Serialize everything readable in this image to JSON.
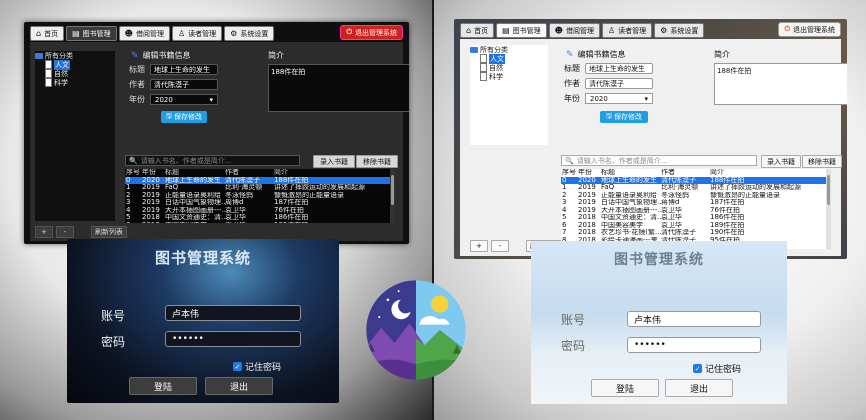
{
  "app": {
    "tabs": [
      {
        "label": "首页",
        "icon": "home-icon"
      },
      {
        "label": "图书管理",
        "icon": "book-icon"
      },
      {
        "label": "借阅管理",
        "icon": "people-icon"
      },
      {
        "label": "读者管理",
        "icon": "user-icon"
      },
      {
        "label": "系统设置",
        "icon": "gear-icon"
      }
    ],
    "logout_label": "退出管理系统"
  },
  "tree": {
    "root": "所有分类",
    "children": [
      "人文",
      "自然",
      "科学"
    ],
    "selected": "人文",
    "buttons": {
      "add": "+",
      "remove": "-",
      "refresh": "刷新列表"
    }
  },
  "editor": {
    "title": "编辑书籍信息",
    "title_label": "标题",
    "title_value": "地球上生命的发生",
    "author_label": "作者",
    "author_value": "清代陈漠子",
    "year_label": "年份",
    "year_value": "2020",
    "intro_label": "简介",
    "intro_value": "188件在拍",
    "save_label": "保存修改"
  },
  "search": {
    "placeholder": "请输入书名、作者或是简介...",
    "import_label": "录入书籍",
    "delete_label": "移除书籍"
  },
  "table": {
    "headers": [
      "序号",
      "年份",
      "标题",
      "作者",
      "简介"
    ],
    "dark_rows": [
      [
        "0",
        "2020",
        "地球上生命的发生",
        "清代陈漠子",
        "188件在拍"
      ],
      [
        "1",
        "2019",
        "FaQ",
        "比利·海灵顿",
        "讲述了摔跤运动的发展和起源"
      ],
      [
        "2",
        "2019",
        "正能量语录奥利给",
        "冬泳怪鸽",
        "慷慨激昂的正能量语录"
      ],
      [
        "3",
        "2019",
        "白话中国气象物理...",
        "周博d",
        "187件在拍"
      ],
      [
        "4",
        "2019",
        "大开本插图画册---...",
        "袁卫华",
        "76件在拍"
      ],
      [
        "5",
        "2018",
        "中国文资通史：清...",
        "袁卫华",
        "186件在拍"
      ],
      [
        "6",
        "2018",
        "中国美容美学",
        "袁卫华",
        "189件在拍"
      ],
      [
        "7",
        "2018",
        "农艺珍书·花镜(繁...",
        "清代陈漠子",
        "190件在拍"
      ],
      [
        "8",
        "2018",
        "彩绘卡通漫画---鬼...",
        "清代陈漠子",
        "95件在拍"
      ]
    ],
    "light_rows": [
      [
        "0",
        "2020",
        "地球上生命的发生",
        "清代陈漠子",
        "188件在拍"
      ],
      [
        "1",
        "2019",
        "FaQ",
        "比利·海灵顿",
        "讲述了摔跤运动的发展和起源"
      ],
      [
        "2",
        "2019",
        "正能量语录奥利给",
        "冬泳怪鸽",
        "慷慨激昂的正能量语录"
      ],
      [
        "3",
        "2019",
        "白话中国气象物理...",
        "蒋博d",
        "187件在拍"
      ],
      [
        "4",
        "2019",
        "大开本插图画册---...",
        "袁卫华",
        "76件在拍"
      ],
      [
        "5",
        "2018",
        "中国文资通史：清...",
        "袁卫华",
        "186件在拍"
      ],
      [
        "6",
        "2018",
        "中国美容美学",
        "袁卫华",
        "189件在拍"
      ],
      [
        "7",
        "2018",
        "农艺珍书·花镜(繁...",
        "清代陈漠子",
        "190件在拍"
      ],
      [
        "8",
        "2018",
        "彩绘卡通漫画---鬼...",
        "清代陈漠子",
        "95件在拍"
      ]
    ]
  },
  "login": {
    "title": "图书管理系统",
    "account_label": "账号",
    "account_value": "卢本伟",
    "password_label": "密码",
    "password_value": "••••••",
    "remember_label": "记住密码",
    "login_label": "登陆",
    "exit_label": "退出"
  },
  "colors": {
    "accent": "#1e73e8",
    "logout_red": "#d0211c",
    "save_blue": "#1f9ee3"
  }
}
